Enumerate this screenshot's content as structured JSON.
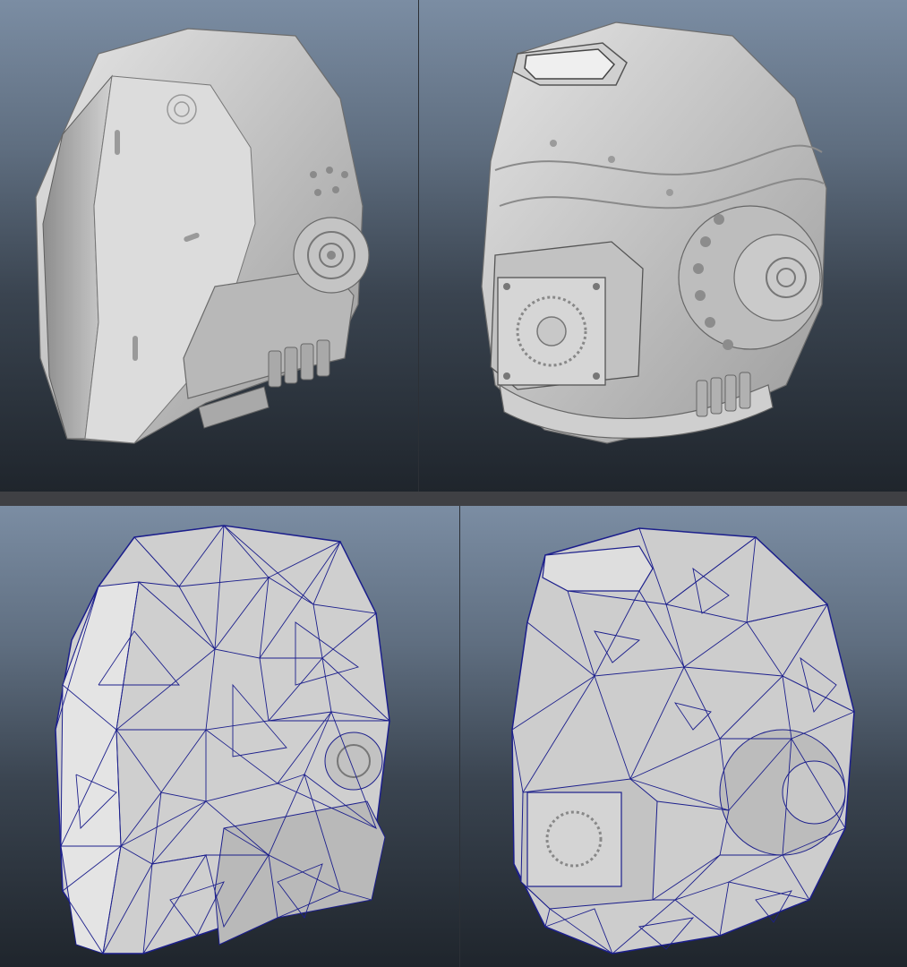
{
  "image": {
    "subject": "3d-helmet-model-turnaround",
    "layout": "2x2-grid",
    "colors": {
      "background_top": "#7b8da3",
      "background_bottom": "#1f252c",
      "model_shading": "#c9c9c9",
      "wireframe": "#1c1f8c",
      "divider": "#3f4044"
    },
    "views": [
      {
        "name": "front-three-quarter",
        "render": "shaded"
      },
      {
        "name": "rear-three-quarter",
        "render": "shaded"
      },
      {
        "name": "front-three-quarter",
        "render": "wireframe-on-shaded"
      },
      {
        "name": "rear-three-quarter",
        "render": "wireframe-on-shaded"
      }
    ]
  }
}
